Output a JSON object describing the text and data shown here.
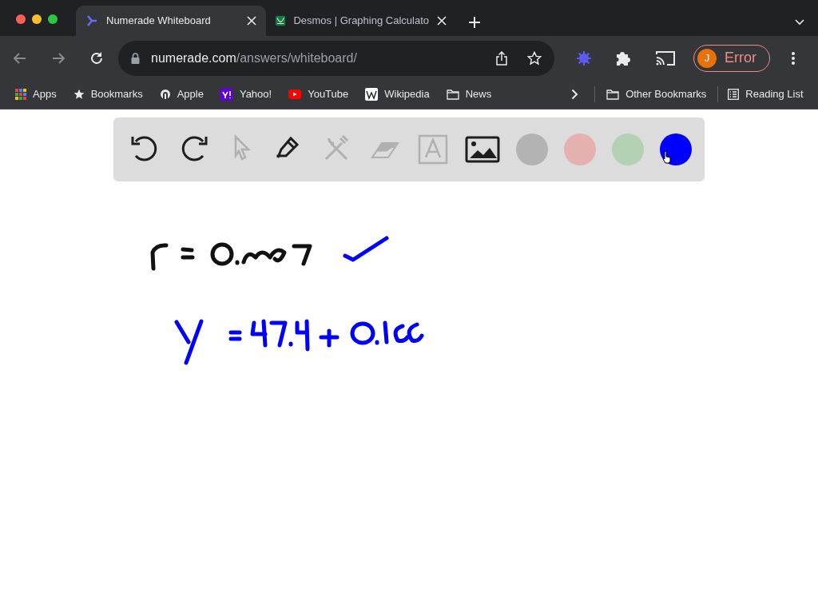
{
  "tabs": [
    {
      "title": "Numerade Whiteboard",
      "kind": "numerade",
      "selected": true
    },
    {
      "title": "Desmos | Graphing Calculato",
      "kind": "desmos",
      "selected": false
    }
  ],
  "address_bar": {
    "host": "numerade.com",
    "path": "/answers/whiteboard/"
  },
  "profile": {
    "initial": "J",
    "label": "Error"
  },
  "bookmarks": [
    {
      "label": "Apps",
      "kind": "apps"
    },
    {
      "label": "Bookmarks",
      "kind": "star"
    },
    {
      "label": "Apple",
      "kind": "apple"
    },
    {
      "label": "Yahoo!",
      "kind": "yahoo"
    },
    {
      "label": "YouTube",
      "kind": "youtube"
    },
    {
      "label": "Wikipedia",
      "kind": "wikipedia"
    },
    {
      "label": "News",
      "kind": "folder"
    }
  ],
  "bookmarks_right": [
    {
      "label": "Other Bookmarks",
      "kind": "folder"
    },
    {
      "label": "Reading List",
      "kind": "list"
    }
  ],
  "toolbar": {
    "tools": [
      {
        "kind": "undo",
        "disabled": false
      },
      {
        "kind": "redo",
        "disabled": false
      },
      {
        "kind": "pointer",
        "disabled": true
      },
      {
        "kind": "pen",
        "disabled": false
      },
      {
        "kind": "tools",
        "disabled": true
      },
      {
        "kind": "eraser",
        "disabled": true
      },
      {
        "kind": "text",
        "disabled": true
      },
      {
        "kind": "image",
        "disabled": false
      }
    ],
    "colors": [
      {
        "color": "#b3b3b3",
        "selected": false
      },
      {
        "color": "#e5b0b0",
        "selected": false
      },
      {
        "color": "#b3d1b3",
        "selected": false
      },
      {
        "color": "#0000ff",
        "selected": true
      }
    ]
  }
}
